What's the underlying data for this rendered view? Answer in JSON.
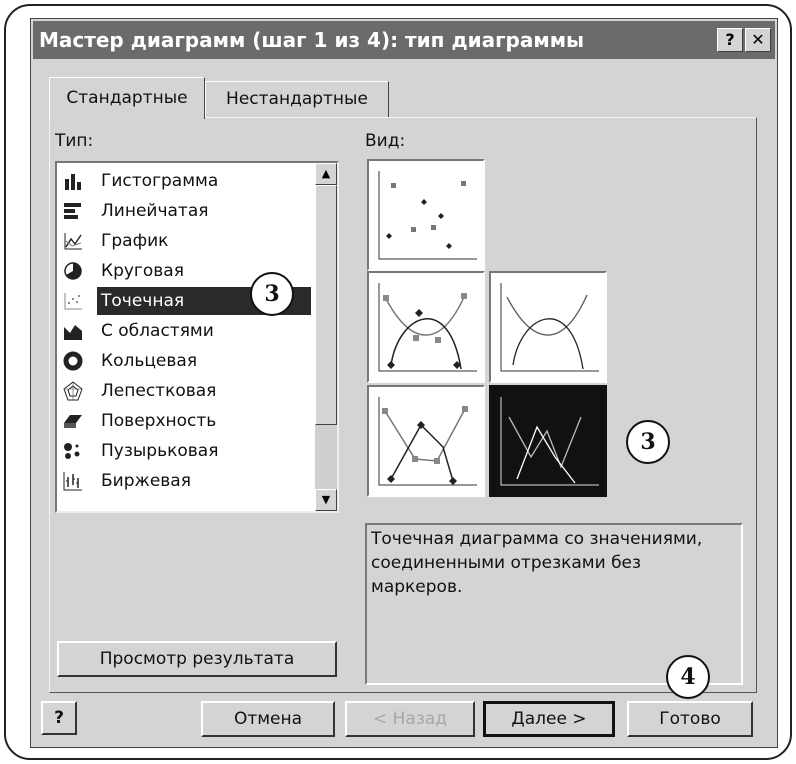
{
  "dialog": {
    "title": "Мастер диаграмм (шаг 1 из 4): тип диаграммы",
    "help_label": "?",
    "close_label": "✕"
  },
  "tabs": [
    {
      "label": "Стандартные",
      "active": true
    },
    {
      "label": "Нестандартные",
      "active": false
    }
  ],
  "type_list": {
    "label": "Тип:",
    "items": [
      {
        "label": "Гистограмма",
        "icon": "column-chart-icon"
      },
      {
        "label": "Линейчатая",
        "icon": "bar-chart-icon"
      },
      {
        "label": "График",
        "icon": "line-chart-icon"
      },
      {
        "label": "Круговая",
        "icon": "pie-chart-icon"
      },
      {
        "label": "Точечная",
        "icon": "scatter-chart-icon",
        "selected": true
      },
      {
        "label": "С областями",
        "icon": "area-chart-icon"
      },
      {
        "label": "Кольцевая",
        "icon": "doughnut-chart-icon"
      },
      {
        "label": "Лепестковая",
        "icon": "radar-chart-icon"
      },
      {
        "label": "Поверхность",
        "icon": "surface-chart-icon"
      },
      {
        "label": "Пузырьковая",
        "icon": "bubble-chart-icon"
      },
      {
        "label": "Биржевая",
        "icon": "stock-chart-icon"
      }
    ]
  },
  "subtype": {
    "label": "Вид:",
    "items": [
      {
        "name": "scatter-markers",
        "selected": false
      },
      {
        "name": "scatter-smooth-markers",
        "selected": false
      },
      {
        "name": "scatter-smooth",
        "selected": false
      },
      {
        "name": "scatter-lines-markers",
        "selected": false
      },
      {
        "name": "scatter-lines",
        "selected": true
      }
    ],
    "description": "Точечная диаграмма со значениями, соединенными отрезками без маркеров."
  },
  "buttons": {
    "preview": "Просмотр результата",
    "help": "?",
    "cancel": "Отмена",
    "back": "< Назад",
    "next": "Далее >",
    "finish": "Готово"
  },
  "callouts": [
    "3",
    "3",
    "4"
  ],
  "colors": {
    "selection": "#2a2a2a",
    "dialog_bg": "#d4d4d4",
    "titlebar": "#6b6b6b"
  }
}
